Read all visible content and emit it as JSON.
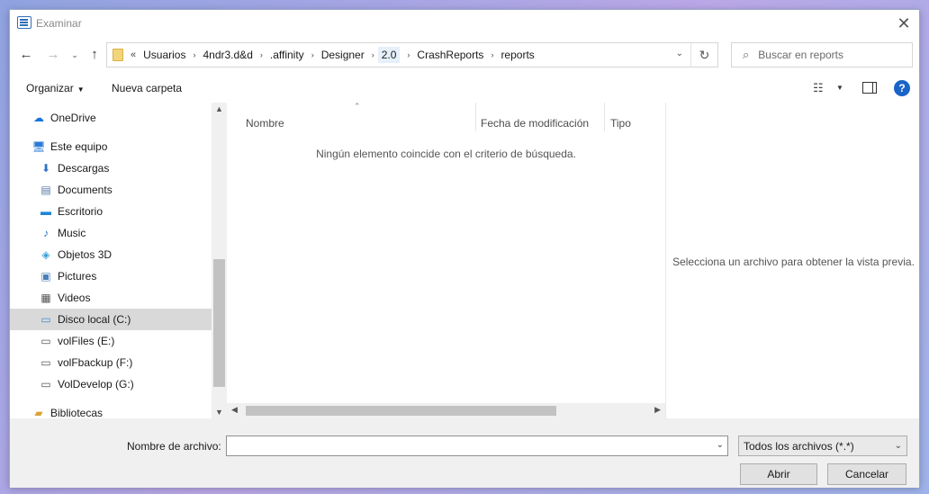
{
  "window": {
    "title": "Examinar",
    "close_glyph": "✕"
  },
  "nav": {
    "back_glyph": "←",
    "forward_glyph": "→",
    "history_glyph": "⌄",
    "up_glyph": "↑",
    "address": {
      "overflow_glyph": "«",
      "crumbs": [
        "Usuarios",
        "4ndr3.d&d",
        ".affinity",
        "Designer",
        "2.0",
        "CrashReports",
        "reports"
      ],
      "separator": "›",
      "dropdown_glyph": "⌄",
      "refresh_glyph": "↻"
    },
    "search": {
      "placeholder": "Buscar en reports",
      "icon_glyph": "⌕"
    }
  },
  "toolbar": {
    "organize_label": "Organizar",
    "organize_caret": "▼",
    "new_folder_label": "Nueva carpeta",
    "view_glyph": "☷",
    "view_caret": "▼",
    "help_glyph": "?"
  },
  "sidebar": {
    "items": [
      {
        "label": "OneDrive",
        "icon": "onedrive-icon",
        "glyph": "☁",
        "color": "#1a73d9"
      },
      {
        "label": "Este equipo",
        "icon": "computer-icon",
        "glyph": "🖥",
        "color": "#2b7bd9"
      },
      {
        "label": "Descargas",
        "icon": "downloads-icon",
        "glyph": "⬇",
        "color": "#2e72c8"
      },
      {
        "label": "Documents",
        "icon": "documents-icon",
        "glyph": "▤",
        "color": "#5a7aa8"
      },
      {
        "label": "Escritorio",
        "icon": "desktop-icon",
        "glyph": "▬",
        "color": "#1f86d6"
      },
      {
        "label": "Music",
        "icon": "music-icon",
        "glyph": "♪",
        "color": "#2b6fc4"
      },
      {
        "label": "Objetos 3D",
        "icon": "objects-3d-icon",
        "glyph": "◈",
        "color": "#3aa0d8"
      },
      {
        "label": "Pictures",
        "icon": "pictures-icon",
        "glyph": "▣",
        "color": "#4a7fb5"
      },
      {
        "label": "Videos",
        "icon": "videos-icon",
        "glyph": "▦",
        "color": "#555555"
      },
      {
        "label": "Disco local (C:)",
        "icon": "drive-c-icon",
        "glyph": "▭",
        "color": "#3a8fd6",
        "selected": true
      },
      {
        "label": "volFiles (E:)",
        "icon": "drive-e-icon",
        "glyph": "▭",
        "color": "#555555"
      },
      {
        "label": "volFbackup (F:)",
        "icon": "drive-f-icon",
        "glyph": "▭",
        "color": "#555555"
      },
      {
        "label": "VolDevelop (G:)",
        "icon": "drive-g-icon",
        "glyph": "▭",
        "color": "#555555"
      },
      {
        "label": "Bibliotecas",
        "icon": "libraries-icon",
        "glyph": "▰",
        "color": "#d9a43a"
      }
    ],
    "scroll_up_glyph": "▲",
    "scroll_down_glyph": "▼"
  },
  "filelist": {
    "columns": [
      "Nombre",
      "Fecha de modificación",
      "Tipo"
    ],
    "sort_glyph": "⌃",
    "empty_message": "Ningún elemento coincide con el criterio de búsqueda.",
    "scroll_left_glyph": "◀",
    "scroll_right_glyph": "▶"
  },
  "preview": {
    "message": "Selecciona un archivo para obtener la vista previa."
  },
  "bottom": {
    "filename_label": "Nombre de archivo:",
    "filename_value": "",
    "filename_dropdown_glyph": "⌄",
    "filter_value": "Todos los archivos (*.*)",
    "filter_dropdown_glyph": "⌄",
    "open_label": "Abrir",
    "cancel_label": "Cancelar"
  }
}
